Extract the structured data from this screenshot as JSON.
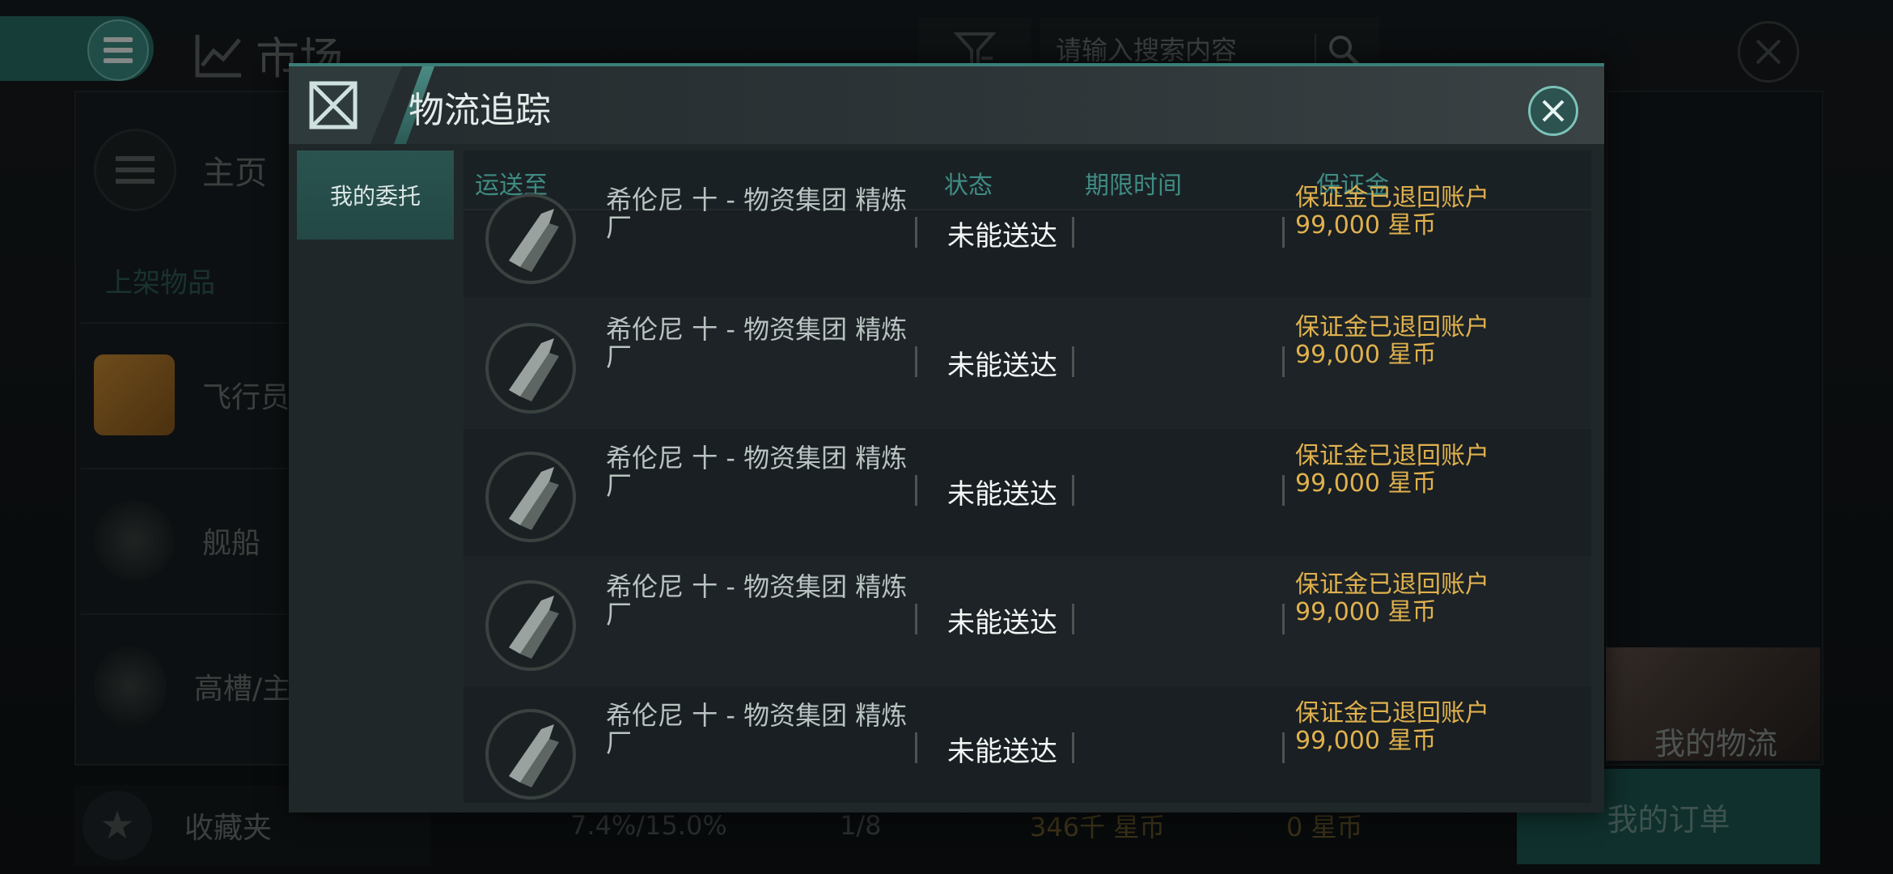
{
  "background": {
    "market_title": "市场",
    "search_placeholder": "请输入搜索内容",
    "home_label": "主页",
    "listed_label": "上架物品",
    "categories": [
      {
        "label": "飞行员"
      },
      {
        "label": "舰船"
      },
      {
        "label": "高槽/主"
      }
    ],
    "favorites_label": "收藏夹",
    "stats": {
      "tax": "7.4%/15.0%",
      "orders": "1/8",
      "balance": "346千 星币",
      "escrow": "0 星币"
    },
    "my_logistics": "我的物流",
    "my_orders": "我的订单"
  },
  "modal": {
    "title": "物流追踪",
    "side_tab": "我的委托",
    "columns": {
      "destination": "运送至",
      "status": "状态",
      "deadline": "期限时间",
      "deposit": "保证金"
    },
    "rows": [
      {
        "destination": "希伦尼 十 - 物资集团 精炼厂",
        "status": "未能送达",
        "deadline": "",
        "deposit_note": "保证金已退回账户",
        "deposit_amount": "99,000 星币"
      },
      {
        "destination": "希伦尼 十 - 物资集团 精炼厂",
        "status": "未能送达",
        "deadline": "",
        "deposit_note": "保证金已退回账户",
        "deposit_amount": "99,000 星币"
      },
      {
        "destination": "希伦尼 十 - 物资集团 精炼厂",
        "status": "未能送达",
        "deadline": "",
        "deposit_note": "保证金已退回账户",
        "deposit_amount": "99,000 星币"
      },
      {
        "destination": "希伦尼 十 - 物资集团 精炼厂",
        "status": "未能送达",
        "deadline": "",
        "deposit_note": "保证金已退回账户",
        "deposit_amount": "99,000 星币"
      },
      {
        "destination": "希伦尼 十 - 物资集团 精炼厂",
        "status": "未能送达",
        "deadline": "",
        "deposit_note": "保证金已退回账户",
        "deposit_amount": "99,000 星币"
      }
    ]
  },
  "colors": {
    "accent": "#3a7f77",
    "deposit_text": "#e0b14e",
    "header_text": "#3f8c84"
  }
}
